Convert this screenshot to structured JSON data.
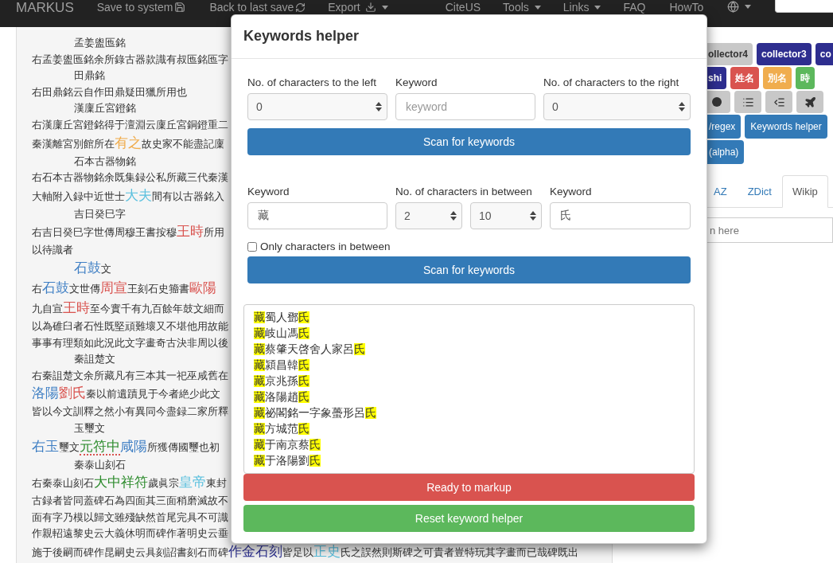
{
  "navbar": {
    "brand": "MARKUS",
    "items": [
      {
        "label": "Save to system",
        "kind": "save"
      },
      {
        "label": "Back to last save",
        "kind": "reload"
      },
      {
        "label": "Export",
        "kind": "export"
      },
      {
        "label": "CiteUS",
        "kind": "link"
      },
      {
        "label": "Tools",
        "kind": "menu"
      },
      {
        "label": "Links",
        "kind": "menu"
      },
      {
        "label": "FAQ",
        "kind": "link"
      },
      {
        "label": "HowTo",
        "kind": "link"
      },
      {
        "kind": "language"
      }
    ]
  },
  "document": {
    "lines": [
      {
        "indent": true,
        "segments": [
          {
            "text": "孟姜盥匜銘"
          }
        ]
      },
      {
        "indent": false,
        "segments": [
          {
            "text": "右孟姜盥匜銘余所錄古器款識有叔匜銘匜字"
          }
        ]
      },
      {
        "indent": true,
        "segments": [
          {
            "text": "田鼎銘"
          }
        ]
      },
      {
        "indent": false,
        "segments": [
          {
            "text": "右田鼎銘云自作田鼎疑田獵所用也"
          }
        ]
      },
      {
        "indent": true,
        "segments": [
          {
            "text": "漢廩丘宮鐙銘"
          }
        ]
      },
      {
        "indent": false,
        "segments": [
          {
            "text": "右漢廩丘宮鐙銘得于澶淵云廩丘宮銅鐙重二"
          }
        ]
      },
      {
        "indent": false,
        "segments": [
          {
            "text": "秦漢離宮別館所在"
          },
          {
            "text": "有之",
            "color": "#f0ad4e"
          },
          {
            "text": "故史家不能盡記廩"
          }
        ]
      },
      {
        "indent": true,
        "segments": [
          {
            "text": "石本古器物銘"
          }
        ]
      },
      {
        "indent": false,
        "segments": [
          {
            "text": "右石本古器物銘余既集録公私所藏三代秦漢"
          }
        ]
      },
      {
        "indent": false,
        "segments": [
          {
            "text": "大軸附入録中近世士"
          },
          {
            "text": "大夫",
            "color": "#5bc0de"
          },
          {
            "text": "間有以古器銘入"
          }
        ]
      },
      {
        "indent": true,
        "segments": [
          {
            "text": "吉日癸巳字"
          }
        ]
      },
      {
        "indent": false,
        "segments": [
          {
            "text": "右吉日癸巳字世傳周穆王書按穆"
          },
          {
            "text": "王時",
            "color": "#d9534f"
          },
          {
            "text": "所用"
          }
        ]
      },
      {
        "indent": false,
        "segments": [
          {
            "text": "以待識者"
          }
        ]
      },
      {
        "indent": true,
        "segments": [
          {
            "text": "石鼓",
            "color": "#3f7fc4"
          },
          {
            "text": "文"
          }
        ]
      },
      {
        "indent": false,
        "segments": [
          {
            "text": "右"
          },
          {
            "text": "石鼓",
            "color": "#3f7fc4"
          },
          {
            "text": "文世傳"
          },
          {
            "text": "周宣",
            "color": "#d9534f"
          },
          {
            "text": "王刻石史籀書"
          },
          {
            "text": "歐陽",
            "color": "#d9534f"
          }
        ]
      },
      {
        "indent": false,
        "segments": [
          {
            "text": "九自宣"
          },
          {
            "text": "王時",
            "color": "#d9534f"
          },
          {
            "text": "至今實千有九百餘年鼓文細而"
          }
        ]
      },
      {
        "indent": false,
        "segments": [
          {
            "text": "以為碓臼者石性既堅頑難壞又不堪他用故能"
          }
        ]
      },
      {
        "indent": false,
        "segments": [
          {
            "text": "事事有理類如此況此文字畫奇古決非周以後"
          }
        ]
      },
      {
        "indent": true,
        "segments": [
          {
            "text": "秦詛楚文"
          }
        ]
      },
      {
        "indent": false,
        "segments": [
          {
            "text": "右秦詛楚文余所藏凡有三本其一祀巫咸舊在"
          }
        ]
      },
      {
        "indent": false,
        "segments": [
          {
            "text": "洛陽",
            "color": "#3f7fc4"
          },
          {
            "text": "劉氏",
            "color": "#d9534f"
          },
          {
            "text": "秦以前遺蹟見于今者絶少此文"
          }
        ]
      },
      {
        "indent": false,
        "segments": [
          {
            "text": "皆以今文訓釋之然小有異同今盡録二家所釋"
          }
        ]
      },
      {
        "indent": true,
        "segments": [
          {
            "text": "玉璽文"
          }
        ]
      },
      {
        "indent": false,
        "segments": [
          {
            "text": "右玉",
            "color": "#3f7fc4"
          },
          {
            "text": "璽文"
          },
          {
            "text": "元符中",
            "color": "#2a8a2a",
            "underlined": true
          },
          {
            "text": "咸陽",
            "color": "#3f7fc4"
          },
          {
            "text": "所獲傳國璽也初"
          }
        ]
      },
      {
        "indent": true,
        "segments": [
          {
            "text": "秦泰山刻石"
          }
        ]
      },
      {
        "indent": false,
        "segments": [
          {
            "text": "右秦泰山刻石"
          },
          {
            "text": "大中祥符",
            "color": "#2a8a2a"
          },
          {
            "text": "歲眞宗"
          },
          {
            "text": "皇帝",
            "color": "#5bc0de"
          },
          {
            "text": "東封"
          }
        ]
      },
      {
        "indent": false,
        "segments": [
          {
            "text": "古録者皆同蓋碑石為四面其三面稍磨滅故不"
          }
        ]
      },
      {
        "indent": false,
        "segments": [
          {
            "text": "面有字乃模以歸文雖殘缺然首尾完具不可識"
          }
        ]
      },
      {
        "indent": false,
        "segments": [
          {
            "text": "作親軺遠黎史云大義休明而碑作著明史云垂"
          }
        ]
      },
      {
        "indent": false,
        "segments": [
          {
            "text": "施于後嗣而碑作昆嗣史云具刻詔書刻石而碑"
          },
          {
            "text": "作金石刻",
            "color": "#2e3192"
          },
          {
            "text": "皆足以"
          },
          {
            "text": "正史",
            "color": "#5bc0de"
          },
          {
            "text": "氏之誤然則斯碑之可貴者豈特玩其字畫而已哉碑既出"
          }
        ]
      }
    ]
  },
  "sidebar": {
    "tag_rows": [
      [
        {
          "label": "ollector4",
          "color": "#c8c8c8"
        },
        {
          "label": "collector3",
          "color": "#2e2e8f"
        },
        {
          "label": "co",
          "color": "#2e2e8f"
        }
      ],
      [
        {
          "label": "shi",
          "color": "#2e2e8f"
        },
        {
          "label": "姓名",
          "color": "#d9534f"
        },
        {
          "label": "別名",
          "color": "#f0ad4e"
        },
        {
          "label": "時",
          "color": "#5cb85c"
        }
      ]
    ],
    "icon_buttons": [
      {
        "kind": "circle"
      },
      {
        "kind": "list"
      },
      {
        "kind": "indent"
      },
      {
        "kind": "plane"
      }
    ],
    "tool_buttons": [
      [
        "/regex",
        "Keywords helper"
      ],
      [
        "(alpha)"
      ]
    ],
    "tabs": [
      {
        "label": "AZ",
        "selected": false
      },
      {
        "label": "ZDict",
        "selected": false
      },
      {
        "label": "Wikip",
        "selected": true
      }
    ],
    "search": {
      "placeholder": "n here"
    }
  },
  "modal": {
    "title": "Keywords helper",
    "scan_surrounding": {
      "left_label": "No. of characters to the left",
      "keyword_label": "Keyword",
      "right_label": "No. of characters to the right",
      "left_count": "0",
      "keyword_placeholder": "keyword",
      "right_count": "0",
      "button": "Scan for keywords"
    },
    "scan_between": {
      "keyword1_label": "Keyword",
      "between_label": "No. of characters in between",
      "keyword2_label": "Keyword",
      "keyword1": "藏",
      "min_between": "2",
      "max_between": "10",
      "keyword2": "氏",
      "only_between": {
        "label": "Only characters in between",
        "checked": false
      },
      "button": "Scan for keywords"
    },
    "results": [
      {
        "first": "藏",
        "middle": "蜀人鄧",
        "last": "氏"
      },
      {
        "first": "藏",
        "middle": "岐山馮",
        "last": "氏"
      },
      {
        "first": "藏",
        "middle": "蔡肇天啓舍人家呂",
        "last": "氏"
      },
      {
        "first": "藏",
        "middle": "潁昌韓",
        "last": "氏"
      },
      {
        "first": "藏",
        "middle": "京兆孫",
        "last": "氏"
      },
      {
        "first": "藏",
        "middle": "洛陽趙",
        "last": "氏"
      },
      {
        "first": "藏",
        "middle": "祕閣銘一字象蠆形呂",
        "last": "氏"
      },
      {
        "first": "藏",
        "middle": "方城范",
        "last": "氏"
      },
      {
        "first": "藏",
        "middle": "于南京蔡",
        "last": "氏"
      },
      {
        "first": "藏",
        "middle": "于洛陽劉",
        "last": "氏"
      }
    ],
    "markup_button": "Ready to markup",
    "reset_button": "Reset keyword helper"
  }
}
